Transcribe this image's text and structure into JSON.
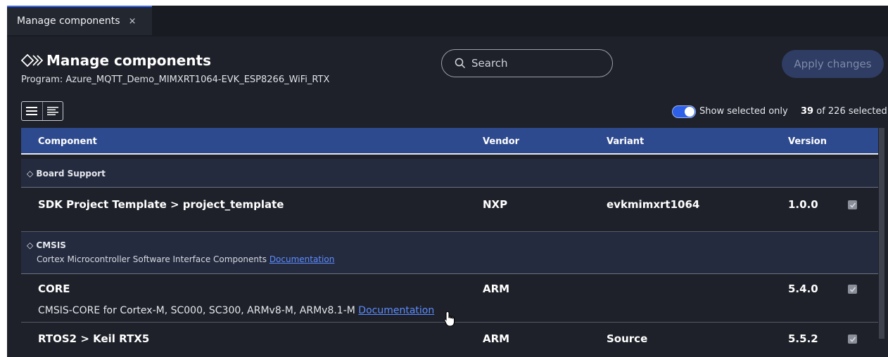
{
  "tab": {
    "label": "Manage components",
    "close": "×"
  },
  "header": {
    "title": "Manage components",
    "program": "Program: Azure_MQTT_Demo_MIMXRT1064-EVK_ESP8266_WiFi_RTX"
  },
  "search": {
    "placeholder": "Search"
  },
  "apply_button": "Apply changes",
  "filter": {
    "show_selected_label": "Show selected only",
    "show_selected_on": true,
    "selected_count": "39",
    "count_rest": "of 226 selected"
  },
  "table": {
    "columns": [
      "Component",
      "Vendor",
      "Variant",
      "Version"
    ],
    "groups": [
      {
        "title": "Board Support",
        "rows": [
          {
            "component": "SDK Project Template > project_template",
            "vendor": "NXP",
            "variant": "evkmimxrt1064",
            "version": "1.0.0",
            "checked": true
          }
        ]
      },
      {
        "title": "CMSIS",
        "subtitle": "Cortex Microcontroller Software Interface Components",
        "subtitle_link": "Documentation",
        "rows": [
          {
            "component": "CORE",
            "vendor": "ARM",
            "variant": "",
            "version": "5.4.0",
            "checked": true,
            "description": "CMSIS-CORE for Cortex-M, SC000, SC300, ARMv8-M, ARMv8.1-M",
            "description_link": "Documentation"
          },
          {
            "component": "RTOS2 > Keil RTX5",
            "vendor": "ARM",
            "variant": "Source",
            "version": "5.5.2",
            "checked": true
          }
        ]
      }
    ]
  },
  "colors": {
    "accent": "#3b6cf3",
    "header_row": "#2e4a8f",
    "group_row": "#252b3f",
    "link": "#5b8cff",
    "background": "#1e2129"
  }
}
